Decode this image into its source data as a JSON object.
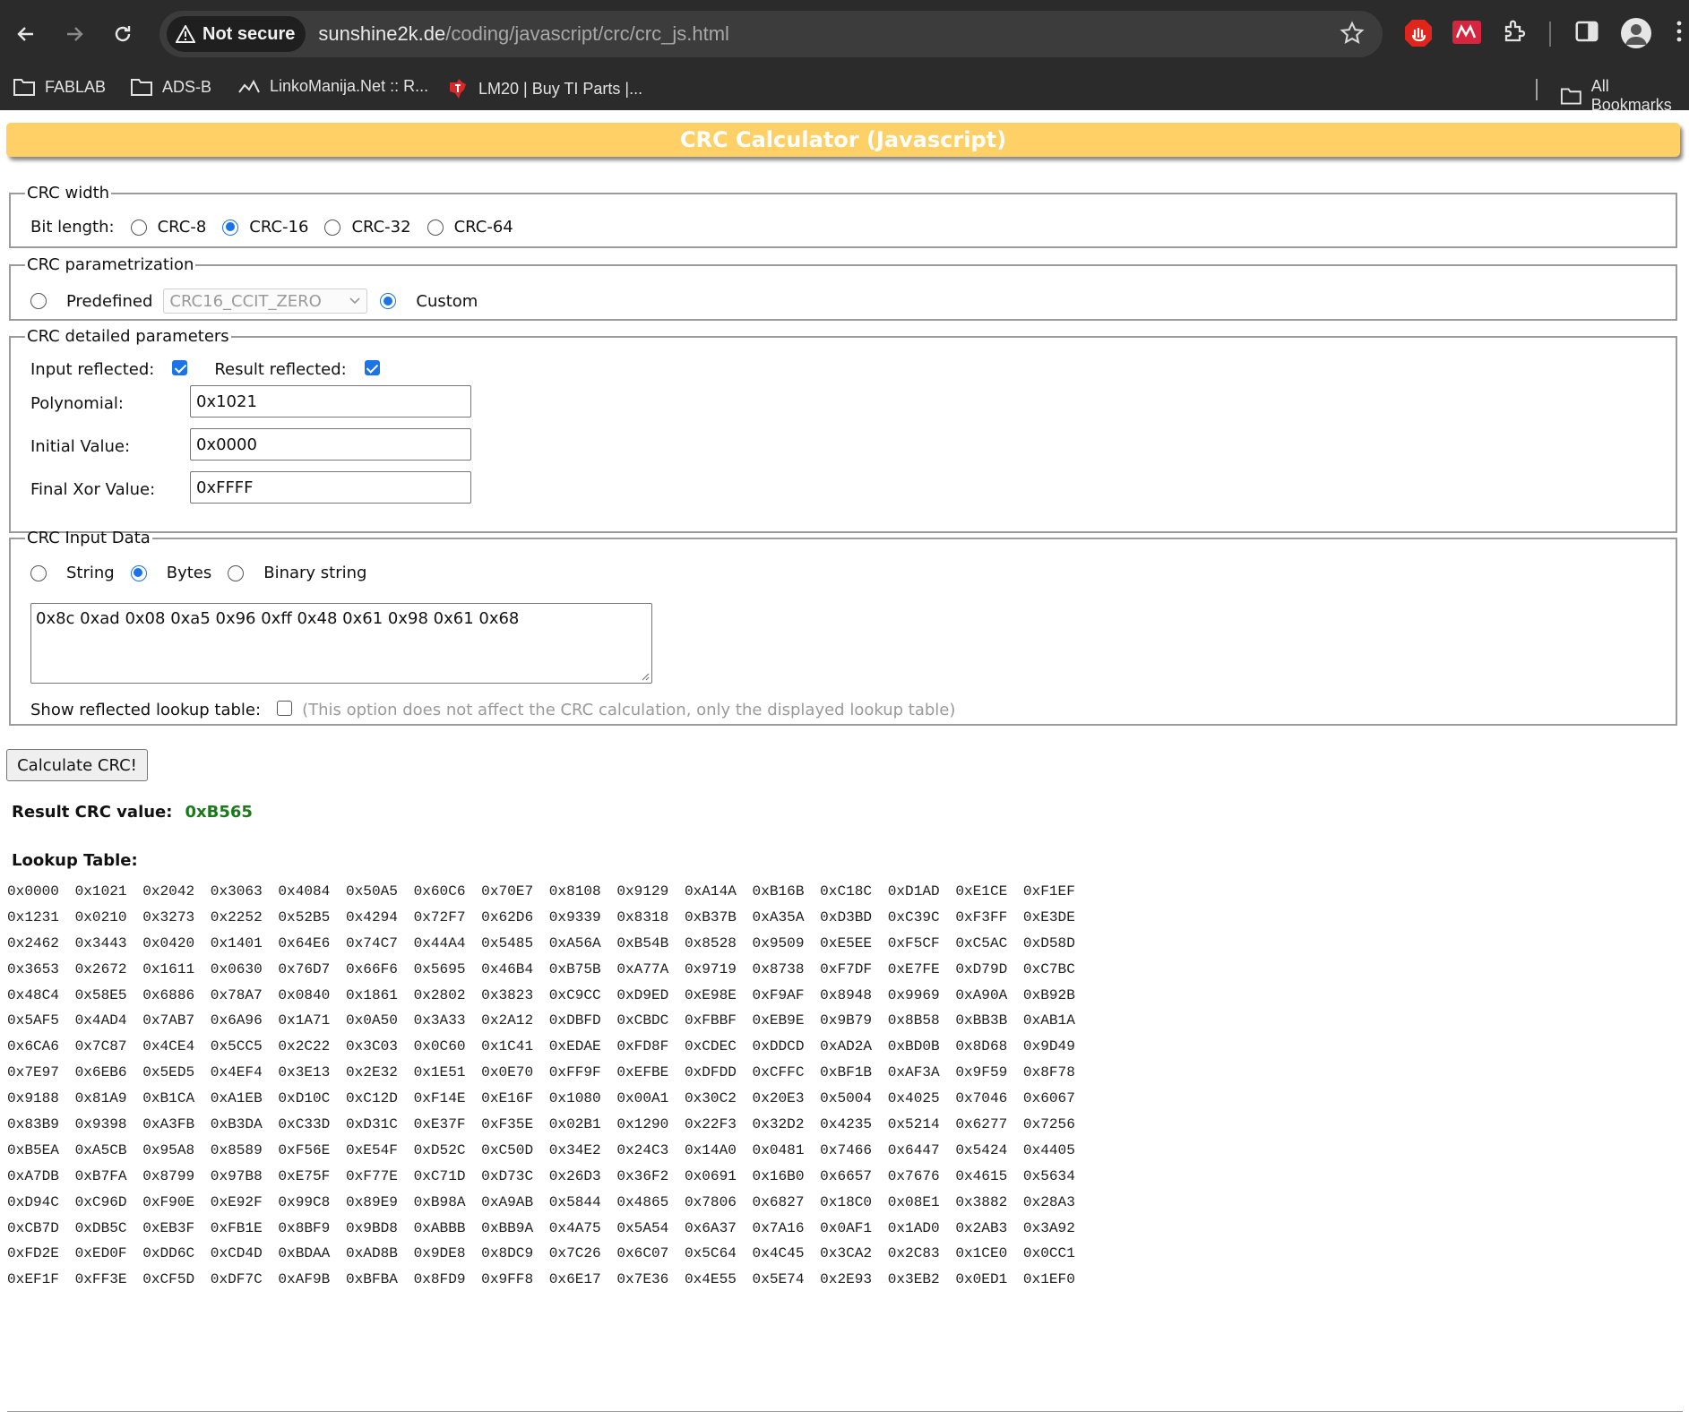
{
  "browser": {
    "security_label": "Not secure",
    "url_host": "sunshine2k.de",
    "url_path": "/coding/javascript/crc/crc_js.html",
    "bookmarks": [
      "FABLAB",
      "ADS-B",
      "LinkoManija.Net :: R...",
      "LM20 | Buy TI Parts |..."
    ],
    "all_bookmarks_label": "All Bookmarks"
  },
  "page": {
    "title": "CRC Calculator (Javascript)"
  },
  "crc_width": {
    "legend": "CRC width",
    "label": "Bit length:",
    "options": [
      "CRC-8",
      "CRC-16",
      "CRC-32",
      "CRC-64"
    ],
    "selected": "CRC-16"
  },
  "parametrization": {
    "legend": "CRC parametrization",
    "predefined_label": "Predefined",
    "predefined_value": "CRC16_CCIT_ZERO",
    "custom_label": "Custom",
    "selected": "Custom"
  },
  "detailed": {
    "legend": "CRC detailed parameters",
    "input_reflected_label": "Input reflected:",
    "input_reflected": true,
    "result_reflected_label": "Result reflected:",
    "result_reflected": true,
    "polynomial_label": "Polynomial:",
    "polynomial": "0x1021",
    "initial_label": "Initial Value:",
    "initial": "0x0000",
    "final_xor_label": "Final Xor Value:",
    "final_xor": "0xFFFF"
  },
  "input_data": {
    "legend": "CRC Input Data",
    "types": [
      "String",
      "Bytes",
      "Binary string"
    ],
    "selected": "Bytes",
    "value": "0x8c 0xad 0x08 0xa5 0x96 0xff 0x48 0x61 0x98 0x61 0x68",
    "show_reflected_label": "Show reflected lookup table:",
    "show_reflected": false,
    "hint": "(This option does not affect the CRC calculation, only the displayed lookup table)"
  },
  "calculate_label": "Calculate CRC!",
  "result": {
    "label": "Result CRC value:",
    "value": "0xB565"
  },
  "lookup": {
    "title": "Lookup Table:",
    "rows": [
      [
        "0x0000",
        "0x1021",
        "0x2042",
        "0x3063",
        "0x4084",
        "0x50A5",
        "0x60C6",
        "0x70E7",
        "0x8108",
        "0x9129",
        "0xA14A",
        "0xB16B",
        "0xC18C",
        "0xD1AD",
        "0xE1CE",
        "0xF1EF"
      ],
      [
        "0x1231",
        "0x0210",
        "0x3273",
        "0x2252",
        "0x52B5",
        "0x4294",
        "0x72F7",
        "0x62D6",
        "0x9339",
        "0x8318",
        "0xB37B",
        "0xA35A",
        "0xD3BD",
        "0xC39C",
        "0xF3FF",
        "0xE3DE"
      ],
      [
        "0x2462",
        "0x3443",
        "0x0420",
        "0x1401",
        "0x64E6",
        "0x74C7",
        "0x44A4",
        "0x5485",
        "0xA56A",
        "0xB54B",
        "0x8528",
        "0x9509",
        "0xE5EE",
        "0xF5CF",
        "0xC5AC",
        "0xD58D"
      ],
      [
        "0x3653",
        "0x2672",
        "0x1611",
        "0x0630",
        "0x76D7",
        "0x66F6",
        "0x5695",
        "0x46B4",
        "0xB75B",
        "0xA77A",
        "0x9719",
        "0x8738",
        "0xF7DF",
        "0xE7FE",
        "0xD79D",
        "0xC7BC"
      ],
      [
        "0x48C4",
        "0x58E5",
        "0x6886",
        "0x78A7",
        "0x0840",
        "0x1861",
        "0x2802",
        "0x3823",
        "0xC9CC",
        "0xD9ED",
        "0xE98E",
        "0xF9AF",
        "0x8948",
        "0x9969",
        "0xA90A",
        "0xB92B"
      ],
      [
        "0x5AF5",
        "0x4AD4",
        "0x7AB7",
        "0x6A96",
        "0x1A71",
        "0x0A50",
        "0x3A33",
        "0x2A12",
        "0xDBFD",
        "0xCBDC",
        "0xFBBF",
        "0xEB9E",
        "0x9B79",
        "0x8B58",
        "0xBB3B",
        "0xAB1A"
      ],
      [
        "0x6CA6",
        "0x7C87",
        "0x4CE4",
        "0x5CC5",
        "0x2C22",
        "0x3C03",
        "0x0C60",
        "0x1C41",
        "0xEDAE",
        "0xFD8F",
        "0xCDEC",
        "0xDDCD",
        "0xAD2A",
        "0xBD0B",
        "0x8D68",
        "0x9D49"
      ],
      [
        "0x7E97",
        "0x6EB6",
        "0x5ED5",
        "0x4EF4",
        "0x3E13",
        "0x2E32",
        "0x1E51",
        "0x0E70",
        "0xFF9F",
        "0xEFBE",
        "0xDFDD",
        "0xCFFC",
        "0xBF1B",
        "0xAF3A",
        "0x9F59",
        "0x8F78"
      ],
      [
        "0x9188",
        "0x81A9",
        "0xB1CA",
        "0xA1EB",
        "0xD10C",
        "0xC12D",
        "0xF14E",
        "0xE16F",
        "0x1080",
        "0x00A1",
        "0x30C2",
        "0x20E3",
        "0x5004",
        "0x4025",
        "0x7046",
        "0x6067"
      ],
      [
        "0x83B9",
        "0x9398",
        "0xA3FB",
        "0xB3DA",
        "0xC33D",
        "0xD31C",
        "0xE37F",
        "0xF35E",
        "0x02B1",
        "0x1290",
        "0x22F3",
        "0x32D2",
        "0x4235",
        "0x5214",
        "0x6277",
        "0x7256"
      ],
      [
        "0xB5EA",
        "0xA5CB",
        "0x95A8",
        "0x8589",
        "0xF56E",
        "0xE54F",
        "0xD52C",
        "0xC50D",
        "0x34E2",
        "0x24C3",
        "0x14A0",
        "0x0481",
        "0x7466",
        "0x6447",
        "0x5424",
        "0x4405"
      ],
      [
        "0xA7DB",
        "0xB7FA",
        "0x8799",
        "0x97B8",
        "0xE75F",
        "0xF77E",
        "0xC71D",
        "0xD73C",
        "0x26D3",
        "0x36F2",
        "0x0691",
        "0x16B0",
        "0x6657",
        "0x7676",
        "0x4615",
        "0x5634"
      ],
      [
        "0xD94C",
        "0xC96D",
        "0xF90E",
        "0xE92F",
        "0x99C8",
        "0x89E9",
        "0xB98A",
        "0xA9AB",
        "0x5844",
        "0x4865",
        "0x7806",
        "0x6827",
        "0x18C0",
        "0x08E1",
        "0x3882",
        "0x28A3"
      ],
      [
        "0xCB7D",
        "0xDB5C",
        "0xEB3F",
        "0xFB1E",
        "0x8BF9",
        "0x9BD8",
        "0xABBB",
        "0xBB9A",
        "0x4A75",
        "0x5A54",
        "0x6A37",
        "0x7A16",
        "0x0AF1",
        "0x1AD0",
        "0x2AB3",
        "0x3A92"
      ],
      [
        "0xFD2E",
        "0xED0F",
        "0xDD6C",
        "0xCD4D",
        "0xBDAA",
        "0xAD8B",
        "0x9DE8",
        "0x8DC9",
        "0x7C26",
        "0x6C07",
        "0x5C64",
        "0x4C45",
        "0x3CA2",
        "0x2C83",
        "0x1CE0",
        "0x0CC1"
      ],
      [
        "0xEF1F",
        "0xFF3E",
        "0xCF5D",
        "0xDF7C",
        "0xAF9B",
        "0xBFBA",
        "0x8FD9",
        "0x9FF8",
        "0x6E17",
        "0x7E36",
        "0x4E55",
        "0x5E74",
        "0x2E93",
        "0x3EB2",
        "0x0ED1",
        "0x1EF0"
      ]
    ]
  }
}
